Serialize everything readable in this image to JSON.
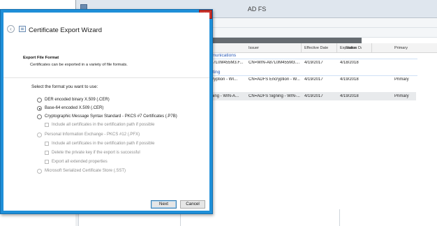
{
  "adfs": {
    "title": "AD FS",
    "columns": [
      "Issuer",
      "Effective Date",
      "Expiration Date",
      "Status",
      "Primary"
    ],
    "groups": [
      {
        "label": "mmunications",
        "row": {
          "name": "A87L0M455M3.F...",
          "issuer": "CN=WIN-A87L0M455M3....",
          "effective": "4/19/2017",
          "expiration": "4/18/2018",
          "status": "",
          "primary": ""
        }
      },
      {
        "label": "ypting",
        "row": {
          "name": "ncryption - WI...",
          "issuer": "CN=ADFS Encryption - W...",
          "effective": "4/19/2017",
          "expiration": "4/19/2018",
          "status": "",
          "primary": "Primary"
        }
      },
      {
        "label": "ng",
        "row": {
          "name": "igning - WIN-A...",
          "issuer": "CN=ADFS Signing - WIN-...",
          "effective": "4/19/2017",
          "expiration": "4/19/2018",
          "status": "",
          "primary": "Primary"
        }
      }
    ]
  },
  "wizard": {
    "close_label": "×",
    "back_icon": "‹",
    "title": "Certificate Export Wizard",
    "section_title": "Export File Format",
    "section_desc": "Certificates can be exported in a variety of file formats.",
    "prompt": "Select the format you want to use:",
    "options": [
      {
        "label": "DER encoded binary X.509 (.CER)",
        "selected": false,
        "enabled": true
      },
      {
        "label": "Base-64 encoded X.509 (.CER)",
        "selected": true,
        "enabled": true
      },
      {
        "label": "Cryptographic Message Syntax Standard - PKCS #7 Certificates (.P7B)",
        "selected": false,
        "enabled": true
      },
      {
        "label": "Include all certificates in the certification path if possible",
        "checked": false,
        "enabled": false
      },
      {
        "label": "Personal Information Exchange - PKCS #12 (.PFX)",
        "selected": false,
        "enabled": false
      },
      {
        "label": "Include all certificates in the certification path if possible",
        "checked": false,
        "enabled": false
      },
      {
        "label": "Delete the private key if the export is successful",
        "checked": false,
        "enabled": false
      },
      {
        "label": "Export all extended properties",
        "checked": false,
        "enabled": false
      },
      {
        "label": "Microsoft Serialized Certificate Store (.SST)",
        "selected": false,
        "enabled": false
      }
    ],
    "next_label": "Next",
    "cancel_label": "Cancel"
  }
}
